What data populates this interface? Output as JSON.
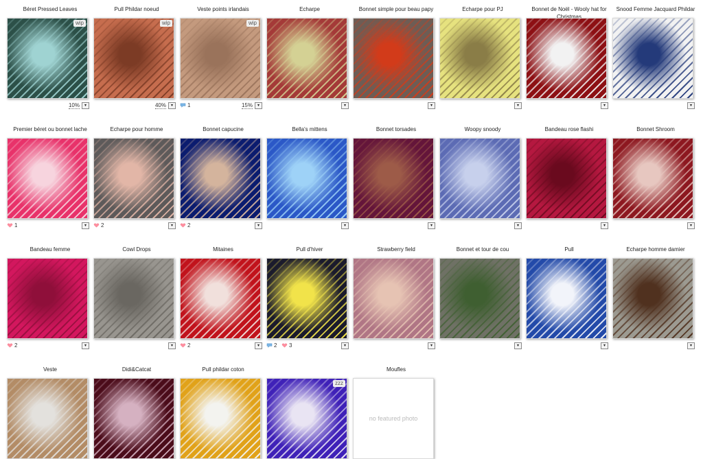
{
  "empty_photo_label": "no featured photo",
  "projects": [
    {
      "title": "Béret Pressed Leaves",
      "badge": "wip",
      "progress": "10%",
      "comments": "",
      "hearts": "",
      "colors": [
        "#2c5048",
        "#9fd3d2"
      ]
    },
    {
      "title": "Pull Phildar noeud",
      "badge": "wip",
      "progress": "40%",
      "comments": "",
      "hearts": "",
      "colors": [
        "#c66d4e",
        "#7c3b25"
      ]
    },
    {
      "title": "Veste points irlandais",
      "badge": "wip",
      "progress": "15%",
      "comments": "1",
      "hearts": "",
      "colors": [
        "#c49a7e",
        "#9a735b"
      ]
    },
    {
      "title": "Echarpe",
      "badge": "",
      "progress": "",
      "comments": "",
      "hearts": "",
      "colors": [
        "#a43a38",
        "#d4d194"
      ]
    },
    {
      "title": "Bonnet simple pour beau papy",
      "badge": "",
      "progress": "",
      "comments": "",
      "hearts": "",
      "colors": [
        "#6d5d55",
        "#d23b1a"
      ]
    },
    {
      "title": "Echarpe pour PJ",
      "badge": "",
      "progress": "",
      "comments": "",
      "hearts": "",
      "colors": [
        "#e6e27f",
        "#8a7d47"
      ]
    },
    {
      "title": "Bonnet de Noël - Wooly hat for Christmas",
      "badge": "",
      "progress": "",
      "comments": "",
      "hearts": "",
      "colors": [
        "#8d1014",
        "#f2f2f2"
      ]
    },
    {
      "title": "Snood Femme Jacquard Phildar",
      "badge": "",
      "progress": "",
      "comments": "",
      "hearts": "",
      "colors": [
        "#f2f2f2",
        "#243a7a"
      ]
    },
    {
      "title": "Premier béret ou bonnet lache",
      "badge": "",
      "progress": "",
      "comments": "",
      "hearts": "1",
      "colors": [
        "#e8326a",
        "#f7d4de"
      ]
    },
    {
      "title": "Echarpe pour homme",
      "badge": "",
      "progress": "",
      "comments": "",
      "hearts": "2",
      "colors": [
        "#5d5a5a",
        "#e2b6a7"
      ]
    },
    {
      "title": "Bonnet capucine",
      "badge": "",
      "progress": "",
      "comments": "",
      "hearts": "2",
      "colors": [
        "#0b1c6f",
        "#d4b49d"
      ]
    },
    {
      "title": "Bella's mittens",
      "badge": "",
      "progress": "",
      "comments": "",
      "hearts": "",
      "colors": [
        "#2b58c7",
        "#9ed2f7"
      ]
    },
    {
      "title": "Bonnet torsades",
      "badge": "",
      "progress": "",
      "comments": "",
      "hearts": "",
      "colors": [
        "#64153a",
        "#9d5b48"
      ]
    },
    {
      "title": "Woopy snoody",
      "badge": "",
      "progress": "",
      "comments": "",
      "hearts": "",
      "colors": [
        "#5c6bb4",
        "#c7d0ec"
      ]
    },
    {
      "title": "Bandeau rose flashi",
      "badge": "",
      "progress": "",
      "comments": "",
      "hearts": "",
      "colors": [
        "#b51840",
        "#6a0a1e"
      ]
    },
    {
      "title": "Bonnet Shroom",
      "badge": "",
      "progress": "",
      "comments": "",
      "hearts": "",
      "colors": [
        "#8d1820",
        "#e7c7c0"
      ]
    },
    {
      "title": "Bandeau femme",
      "badge": "",
      "progress": "",
      "comments": "",
      "hearts": "2",
      "colors": [
        "#d3175e",
        "#8f0f3a"
      ]
    },
    {
      "title": "Cowl Drops",
      "badge": "",
      "progress": "",
      "comments": "",
      "hearts": "",
      "colors": [
        "#98958f",
        "#6a6761"
      ]
    },
    {
      "title": "Mitaines",
      "badge": "",
      "progress": "",
      "comments": "",
      "hearts": "2",
      "colors": [
        "#c1131c",
        "#f1e0dc"
      ]
    },
    {
      "title": "Pull d'hiver",
      "badge": "",
      "progress": "",
      "comments": "2",
      "hearts": "3",
      "colors": [
        "#1b1b2c",
        "#f1e34a"
      ]
    },
    {
      "title": "Strawberry field",
      "badge": "",
      "progress": "",
      "comments": "",
      "hearts": "",
      "colors": [
        "#b07685",
        "#e6c3b3"
      ]
    },
    {
      "title": "Bonnet et tour de cou",
      "badge": "",
      "progress": "",
      "comments": "",
      "hearts": "",
      "colors": [
        "#6f7165",
        "#3f5f31"
      ]
    },
    {
      "title": "Pull",
      "badge": "",
      "progress": "",
      "comments": "",
      "hearts": "",
      "colors": [
        "#234aa9",
        "#f2f4fa"
      ]
    },
    {
      "title": "Echarpe homme damier",
      "badge": "",
      "progress": "",
      "comments": "",
      "hearts": "",
      "colors": [
        "#9c9a91",
        "#50311f"
      ]
    },
    {
      "title": "Veste",
      "badge": "",
      "progress": "",
      "comments": "",
      "hearts": "",
      "colors": [
        "#b38c66",
        "#e3e1dd"
      ]
    },
    {
      "title": "Didi&Catcat",
      "badge": "",
      "progress": "",
      "comments": "",
      "hearts": "",
      "colors": [
        "#4b0c1a",
        "#d5b1c1"
      ]
    },
    {
      "title": "Pull phildar coton",
      "badge": "",
      "progress": "",
      "comments": "",
      "hearts": "",
      "colors": [
        "#e1a219",
        "#f3f3ef"
      ]
    },
    {
      "title": "",
      "badge": "zzz",
      "progress": "",
      "comments": "",
      "hearts": "",
      "colors": [
        "#3f21b8",
        "#e9e4f3"
      ]
    },
    {
      "title": "Moufles",
      "badge": "",
      "progress": "",
      "comments": "",
      "hearts": "",
      "colors": []
    }
  ],
  "icons": {
    "dropdown": "chevron-down-icon",
    "comment": "comment-bubble-icon",
    "heart": "heart-icon"
  }
}
